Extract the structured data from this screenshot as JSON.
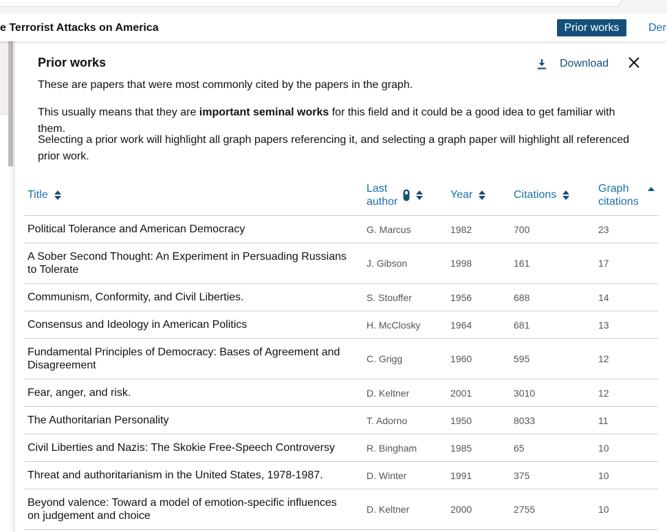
{
  "header": {
    "graph_title": "e Terrorist Attacks on America",
    "tabs": [
      {
        "label": "Prior works",
        "active": true
      },
      {
        "label": "Deri",
        "active": false
      }
    ]
  },
  "panel": {
    "title": "Prior works",
    "download_label": "Download",
    "description": {
      "p1": "These are papers that were most commonly cited by the papers in the graph.",
      "p2_before": "This usually means that they are ",
      "p2_bold": "important seminal works",
      "p2_after": " for this field and it could be a good idea to get familiar with them.",
      "p3": "Selecting a prior work will highlight all graph papers referencing it, and selecting a graph paper will highlight all referenced prior work."
    }
  },
  "table": {
    "columns": {
      "title": "Title",
      "last_author_1": "Last",
      "last_author_2": "author",
      "year": "Year",
      "citations": "Citations",
      "graph_citations_1": "Graph",
      "graph_citations_2": "citations"
    },
    "rows": [
      {
        "title": "Political Tolerance and American Democracy",
        "author": "G. Marcus",
        "year": "1982",
        "citations": "700",
        "graph_citations": "23"
      },
      {
        "title": "A Sober Second Thought: An Experiment in Persuading Russians to Tolerate",
        "author": "J. Gibson",
        "year": "1998",
        "citations": "161",
        "graph_citations": "17"
      },
      {
        "title": "Communism, Conformity, and Civil Liberties.",
        "author": "S. Stouffer",
        "year": "1956",
        "citations": "688",
        "graph_citations": "14"
      },
      {
        "title": "Consensus and Ideology in American Politics",
        "author": "H. McClosky",
        "year": "1964",
        "citations": "681",
        "graph_citations": "13"
      },
      {
        "title": "Fundamental Principles of Democracy: Bases of Agreement and Disagreement",
        "author": "C. Grigg",
        "year": "1960",
        "citations": "595",
        "graph_citations": "12"
      },
      {
        "title": "Fear, anger, and risk.",
        "author": "D. Keltner",
        "year": "2001",
        "citations": "3010",
        "graph_citations": "12"
      },
      {
        "title": "The Authoritarian Personality",
        "author": "T. Adorno",
        "year": "1950",
        "citations": "8033",
        "graph_citations": "11"
      },
      {
        "title": "Civil Liberties and Nazis: The Skokie Free-Speech Controversy",
        "author": "R. Bingham",
        "year": "1985",
        "citations": "65",
        "graph_citations": "10"
      },
      {
        "title": "Threat and authoritarianism in the United States, 1978-1987.",
        "author": "D. Winter",
        "year": "1991",
        "citations": "375",
        "graph_citations": "10"
      },
      {
        "title": "Beyond valence: Toward a model of emotion-specific influences on judgement and choice",
        "author": "D. Keltner",
        "year": "2000",
        "citations": "2755",
        "graph_citations": "10"
      }
    ]
  },
  "colors": {
    "accent": "#14507a",
    "link": "#1a6fa8"
  },
  "icons": {
    "download": "download-icon",
    "close": "close-icon",
    "sort": "sort-icon",
    "filter": "filter-icon",
    "sort_up": "sort-up-icon"
  }
}
